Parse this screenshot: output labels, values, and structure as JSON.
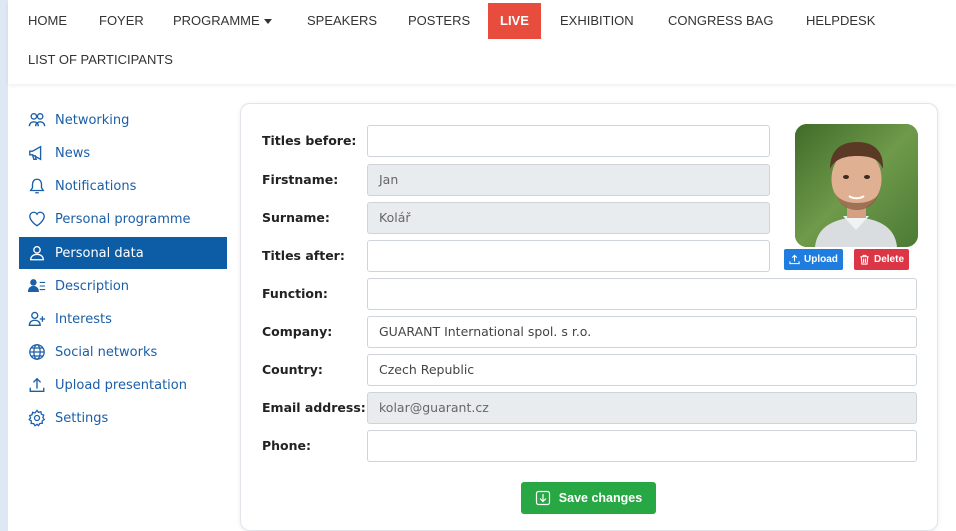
{
  "nav": {
    "items": [
      {
        "label": "HOME"
      },
      {
        "label": "FOYER"
      },
      {
        "label": "PROGRAMME"
      },
      {
        "label": "SPEAKERS"
      },
      {
        "label": "POSTERS"
      },
      {
        "label": "LIVE"
      },
      {
        "label": "EXHIBITION"
      },
      {
        "label": "CONGRESS BAG"
      },
      {
        "label": "HELPDESK"
      },
      {
        "label": "LIST OF PARTICIPANTS"
      }
    ],
    "live_color": "#e74c3c"
  },
  "sidebar": {
    "items": [
      {
        "label": "Networking",
        "icon": "networking-icon"
      },
      {
        "label": "News",
        "icon": "megaphone-icon"
      },
      {
        "label": "Notifications",
        "icon": "bell-icon"
      },
      {
        "label": "Personal programme",
        "icon": "heart-icon"
      },
      {
        "label": "Personal data",
        "icon": "user-icon",
        "active": true
      },
      {
        "label": "Description",
        "icon": "user-list-icon"
      },
      {
        "label": "Interests",
        "icon": "user-plus-icon"
      },
      {
        "label": "Social networks",
        "icon": "globe-icon"
      },
      {
        "label": "Upload presentation",
        "icon": "upload-icon"
      },
      {
        "label": "Settings",
        "icon": "gear-icon"
      }
    ],
    "active_color": "#0d5ca6"
  },
  "form": {
    "titles_before": {
      "label": "Titles before:",
      "value": ""
    },
    "firstname": {
      "label": "Firstname:",
      "value": "Jan"
    },
    "surname": {
      "label": "Surname:",
      "value": "Kolář"
    },
    "titles_after": {
      "label": "Titles after:",
      "value": ""
    },
    "function": {
      "label": "Function:",
      "value": ""
    },
    "company": {
      "label": "Company:",
      "value": "GUARANT International spol. s r.o."
    },
    "country": {
      "label": "Country:",
      "value": "Czech Republic"
    },
    "email": {
      "label": "Email address:",
      "value": "kolar@guarant.cz"
    },
    "phone": {
      "label": "Phone:",
      "value": ""
    },
    "upload_label": "Upload",
    "delete_label": "Delete",
    "save_label": "Save changes"
  },
  "colors": {
    "upload": "#1f7de0",
    "delete": "#dc3545",
    "save": "#28a745"
  }
}
